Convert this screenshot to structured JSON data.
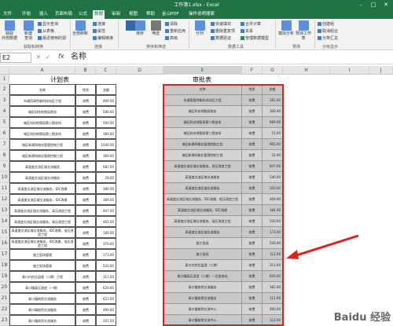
{
  "window": {
    "title": "工作簿1.xlsx - Excel"
  },
  "tabs": [
    {
      "label": "文件"
    },
    {
      "label": "开始"
    },
    {
      "label": "插入"
    },
    {
      "label": "页面布局"
    },
    {
      "label": "公式"
    },
    {
      "label": "数据"
    },
    {
      "label": "审阅"
    },
    {
      "label": "视图"
    },
    {
      "label": "帮助"
    },
    {
      "label": "金山PDF"
    },
    {
      "label": "操作说明搜索"
    }
  ],
  "active_tab_index": 5,
  "ribbon": {
    "get_data": "获取\n外部数据",
    "new_query": "新建\n查询",
    "show_query": "显示查询",
    "from_table": "从表格",
    "recent_sources": "最近使用的源",
    "group_get_transform": "获取和转换",
    "refresh_all": "全部刷新",
    "connections": "连接",
    "properties": "属性",
    "edit_links": "编辑链接",
    "group_connections": "连接",
    "sort": "排序",
    "filter": "筛选",
    "clear": "清除",
    "reapply": "重新应用",
    "advanced": "高级",
    "group_sort_filter": "排序和筛选",
    "text_to_columns": "分列",
    "flash_fill": "快速填充",
    "remove_duplicates": "删除重复项",
    "data_validation": "数据验证",
    "consolidate": "合并计算",
    "relationships": "关系",
    "data_model": "管理数据模型",
    "group_data_tools": "数据工具",
    "what_if": "模拟分析",
    "forecast_sheet": "预测工作表",
    "group_forecast": "预测",
    "group": "创建组",
    "ungroup": "取消组合",
    "subtotal": "分类汇总",
    "group_outline": "分级显示"
  },
  "formula_bar": {
    "namebox": "E2",
    "fx": "fx",
    "value": "名称"
  },
  "columns": [
    "A",
    "B",
    "C",
    "D",
    "E",
    "F",
    "G",
    "H",
    "I",
    "J"
  ],
  "selected_column": "E",
  "rows": [
    "1",
    "2",
    "3",
    "4",
    "5",
    "6",
    "7",
    "8",
    "9",
    "10",
    "11",
    "12",
    "13",
    "14",
    "15",
    "16",
    "17",
    "18",
    "19",
    "20",
    "21",
    "22",
    "23"
  ],
  "sheet_left": {
    "title": "计划表",
    "headers": [
      "名称",
      "性质",
      "金额"
    ],
    "items": [
      [
        "市通用高性能科技站区工程",
        "收费",
        "490.00"
      ],
      [
        "城区科技地税局税务",
        "收费",
        "580.00"
      ],
      [
        "城区科技地税局第二税务所",
        "收费",
        "560.00"
      ],
      [
        "城区科技地税局第三税务所",
        "收费",
        "380.00"
      ],
      [
        "城区新建网络化管理控制工程",
        "收费",
        "1040.00"
      ],
      [
        "城区新建网络化管理控制工程",
        "收费",
        "380.00"
      ],
      [
        "高速度交流区域交流服务",
        "收费",
        "681.00"
      ],
      [
        "高速度交流区域交流服务",
        "收费",
        "29.00"
      ],
      [
        "高速度交流区域交流服务，IDC改建",
        "收费",
        "380.00"
      ],
      [
        "高速度交流区域交流服务，IDC改建",
        "收费",
        "389.00"
      ],
      [
        "高速度交流区域交流服务，高压改造工程",
        "收费",
        "947.00"
      ],
      [
        "高速度交流区域交流服务，高压改造工程",
        "收费",
        "465.00"
      ],
      [
        "高速度交流区域交流服务，IDC改建，低压改造工程",
        "收费",
        "189.00"
      ],
      [
        "高速度交流区域交流服务，IDC改建，低压改造工程",
        "收费",
        "370.00"
      ],
      [
        "施工现场管理",
        "收费",
        "173.00"
      ],
      [
        "施工现场管理",
        "收费",
        "520.00"
      ],
      [
        "青口内控总监理（二期）工程",
        "收费",
        "311.00"
      ],
      [
        "青口镇高压改造（一期）",
        "收费",
        "620.00"
      ],
      [
        "青口镇商贸交流服务",
        "收费",
        "621.00"
      ],
      [
        "青口镇商贸交流服务",
        "收费",
        "490.00"
      ],
      [
        "青口镇商贸交流服务",
        "收费",
        "341.00"
      ]
    ]
  },
  "sheet_right": {
    "title": "审批表",
    "headers": [
      "名称",
      "性质",
      "金额"
    ],
    "items": [
      [
        "市通用高性能科技站区工程",
        "收费",
        "381.00"
      ],
      [
        "城区科技地税局税务",
        "收费",
        "300.00"
      ],
      [
        "城区科技地税局第二税务所",
        "收费",
        "969.00"
      ],
      [
        "城区科技地税局第三税务所",
        "收费",
        "15.00"
      ],
      [
        "城区新建网络化管理控制工程",
        "收费",
        "965.00"
      ],
      [
        "城区新建网络化管理控制工程",
        "收费",
        "32.00"
      ],
      [
        "高速度交流区域交流服务，高压改造工程",
        "收费",
        "847.00"
      ],
      [
        "高速度交流区域交流服务",
        "收费",
        "540.00"
      ],
      [
        "高速度交流区域交流服务",
        "收费",
        "350.00"
      ],
      [
        "高速度交流区域交流服务，IDC改建，低压改造工程",
        "收费",
        "469.00"
      ],
      [
        "高速度交流区域交流服务，IDC改建",
        "收费",
        "184.00"
      ],
      [
        "高速度交流区域交流服务，低压改造工程",
        "收费",
        "520.00"
      ],
      [
        "高速度交流区域交流服务",
        "收费",
        "173.00"
      ],
      [
        "施工现场",
        "收费",
        "520.00"
      ],
      [
        "施工现场",
        "收费",
        "112.00"
      ],
      [
        "青口内控总监理（二期）",
        "收费",
        "311.00"
      ],
      [
        "青口镇高压改造（二期）一位变电站",
        "收费",
        "620.00"
      ],
      [
        "青口镇商贸交流服务",
        "收费",
        "182.00"
      ],
      [
        "青口镇商贸交流服务",
        "收费",
        "111.00"
      ],
      [
        "青口镇商贸交流中心",
        "收费",
        "490.00"
      ],
      [
        "青口镇商贸交流中心",
        "收费",
        "112.00"
      ]
    ]
  },
  "watermark": "Baidu 经验"
}
